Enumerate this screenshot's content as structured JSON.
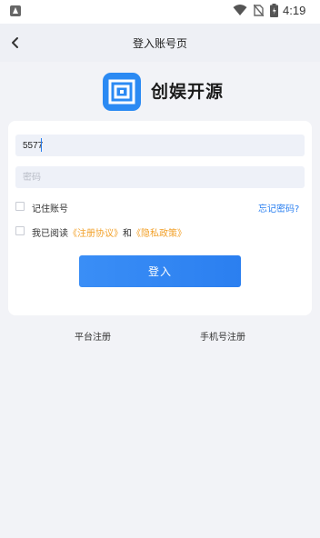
{
  "status_bar": {
    "time": "4:19",
    "icons": [
      "app-notification-icon",
      "wifi-icon",
      "no-sim-icon",
      "battery-icon"
    ]
  },
  "nav": {
    "title": "登入账号页",
    "back_icon": "chevron-left-icon"
  },
  "brand": {
    "logo_icon": "app-logo-icon",
    "logo_color": "#2b8af3",
    "name": "创娱开源"
  },
  "form": {
    "username": {
      "value": "5577",
      "placeholder": ""
    },
    "password": {
      "value": "",
      "placeholder": "密码"
    },
    "remember_label": "记住账号",
    "forgot_label": "忘记密码?",
    "agree_prefix": "我已阅读",
    "agree_terms": "《注册协议》",
    "agree_and": "和",
    "agree_privacy": "《隐私政策》",
    "submit_label": "登入"
  },
  "footer": {
    "platform_register": "平台注册",
    "phone_register": "手机号注册"
  },
  "colors": {
    "accent": "#2b7ff0",
    "link_orange": "#f2a12a",
    "background": "#f2f3f7",
    "input_bg": "#eef1f8"
  }
}
